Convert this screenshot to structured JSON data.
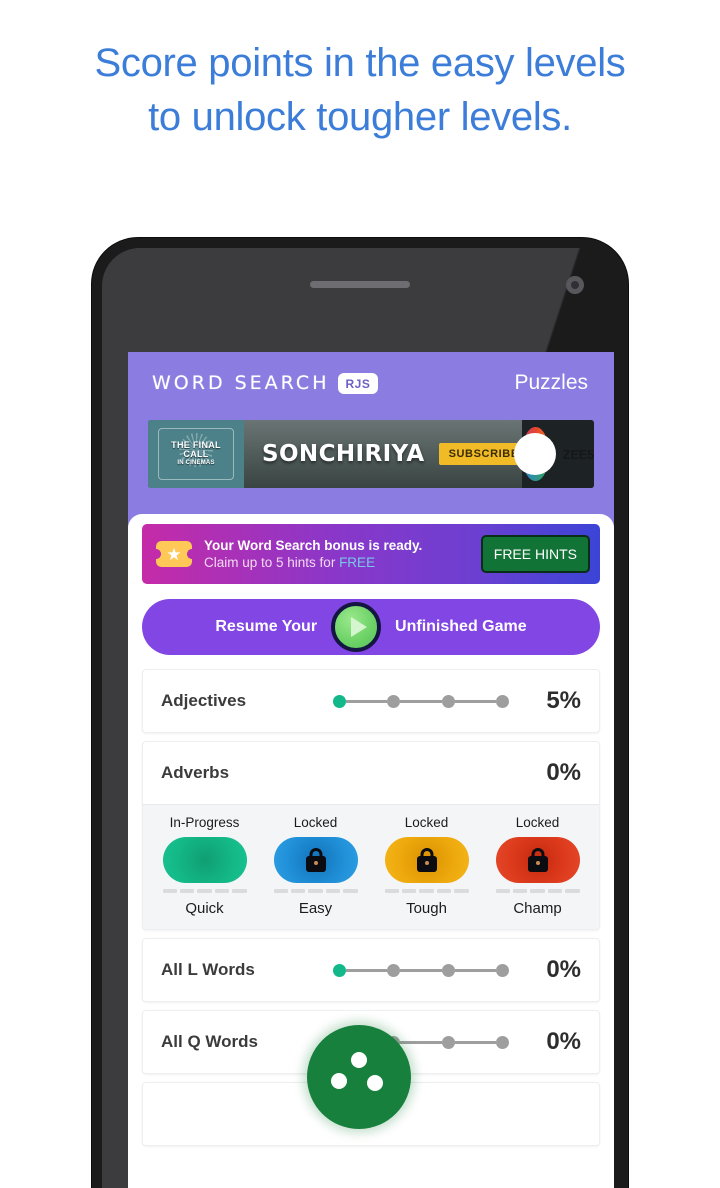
{
  "promo": {
    "line1": "Score points in the easy levels",
    "line2": "to unlock tougher levels.",
    "color": "#3b7dd8"
  },
  "app": {
    "header": {
      "brand_title": "WORD SEARCH",
      "brand_badge": "RJS",
      "screen_title": "Puzzles",
      "background_color": "#8a7ce0"
    },
    "ad": {
      "logo_text": "THE FINAL CALL",
      "logo_subtext": "IN CINEMAS",
      "title": "SONCHIRIYA",
      "cta_label": "SUBSCRIBE NOW",
      "brand": "ZEE5",
      "cta_color": "#f0bb26"
    },
    "bonus": {
      "icon": "star-ticket-icon",
      "line1": "Your Word Search bonus is ready.",
      "line2_prefix": "Claim up to 5 hints for ",
      "line2_highlight": "FREE",
      "button_label": "FREE HINTS",
      "button_color": "#127337"
    },
    "resume": {
      "text_left": "Resume Your",
      "text_right": "Unfinished Game",
      "icon": "play-icon",
      "background_color": "#8146e4"
    },
    "puzzles": [
      {
        "name": "Adjectives",
        "percent": "5%",
        "dots_total": 4,
        "dots_active": 1,
        "expanded": false
      },
      {
        "name": "Adverbs",
        "percent": "0%",
        "dots_total": 4,
        "dots_active": 1,
        "expanded": true,
        "levels": [
          {
            "status": "In-Progress",
            "name": "Quick",
            "locked": false,
            "color": "#14b887",
            "segments": 5,
            "segments_filled": 0
          },
          {
            "status": "Locked",
            "name": "Easy",
            "locked": true,
            "color": "#1f8ed6",
            "segments": 5,
            "segments_filled": 0
          },
          {
            "status": "Locked",
            "name": "Tough",
            "locked": true,
            "color": "#eda80d",
            "segments": 5,
            "segments_filled": 0
          },
          {
            "status": "Locked",
            "name": "Champ",
            "locked": true,
            "color": "#dd3a1c",
            "segments": 5,
            "segments_filled": 0
          }
        ]
      },
      {
        "name": "All L Words",
        "percent": "0%",
        "dots_total": 4,
        "dots_active": 1,
        "expanded": false
      },
      {
        "name": "All Q Words",
        "percent": "0%",
        "dots_total": 4,
        "dots_active": 1,
        "expanded": false
      }
    ],
    "touch_cursor": {
      "icon": "touch-pointer-icon",
      "color": "#17803c"
    }
  }
}
